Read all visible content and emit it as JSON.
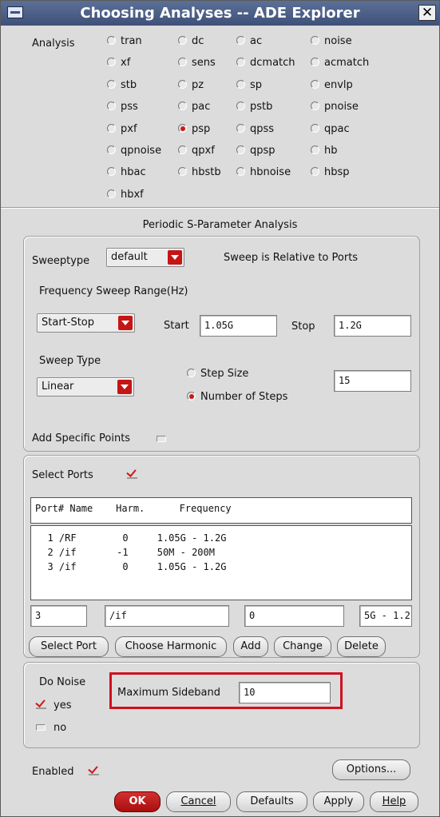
{
  "window": {
    "title": "Choosing Analyses -- ADE Explorer"
  },
  "analysis": {
    "label": "Analysis",
    "options": [
      [
        "tran",
        "dc",
        "ac",
        "noise"
      ],
      [
        "xf",
        "sens",
        "dcmatch",
        "acmatch"
      ],
      [
        "stb",
        "pz",
        "sp",
        "envlp"
      ],
      [
        "pss",
        "pac",
        "pstb",
        "pnoise"
      ],
      [
        "pxf",
        "psp",
        "qpss",
        "qpac"
      ],
      [
        "qpnoise",
        "qpxf",
        "qpsp",
        "hb"
      ],
      [
        "hbac",
        "hbstb",
        "hbnoise",
        "hbsp"
      ],
      [
        "hbxf"
      ]
    ],
    "selected": "psp"
  },
  "section_title": "Periodic S-Parameter Analysis",
  "sweep": {
    "sweeptype_label": "Sweeptype",
    "sweeptype_value": "default",
    "relative_note": "Sweep is Relative to Ports",
    "range_label": "Frequency Sweep Range(Hz)",
    "range_mode": "Start-Stop",
    "start_label": "Start",
    "start_value": "1.05G",
    "stop_label": "Stop",
    "stop_value": "1.2G",
    "sweep_type_label": "Sweep Type",
    "sweep_type_value": "Linear",
    "step_size_label": "Step Size",
    "num_steps_label": "Number of Steps",
    "selected_mode": "Number of Steps",
    "steps_value": "15",
    "add_specific_label": "Add Specific Points",
    "add_specific_checked": false
  },
  "ports": {
    "select_label": "Select Ports",
    "select_checked": true,
    "header": "Port# Name    Harm.      Frequency",
    "rows": [
      "  1 /RF        0     1.05G - 1.2G",
      "  2 /if       -1     50M - 200M",
      "  3 /if        0     1.05G - 1.2G"
    ],
    "edit_port": "3",
    "edit_name": "/if",
    "edit_harm": "0",
    "edit_freq": "5G - 1.2",
    "buttons": [
      "Select Port",
      "Choose Harmonic",
      "Add",
      "Change",
      "Delete"
    ]
  },
  "noise": {
    "do_noise_label": "Do Noise",
    "yes_label": "yes",
    "no_label": "no",
    "yes_checked": true,
    "max_sideband_label": "Maximum Sideband",
    "max_sideband_value": "10"
  },
  "footer": {
    "enabled_label": "Enabled",
    "enabled_checked": true,
    "options_button": "Options...",
    "ok_button": "OK",
    "cancel_button": "Cancel",
    "defaults_button": "Defaults",
    "apply_button": "Apply",
    "help_button": "Help"
  },
  "colors": {
    "titlebar": "#4a5d86",
    "accent_red": "#d01818",
    "highlight_box": "#d01020"
  }
}
